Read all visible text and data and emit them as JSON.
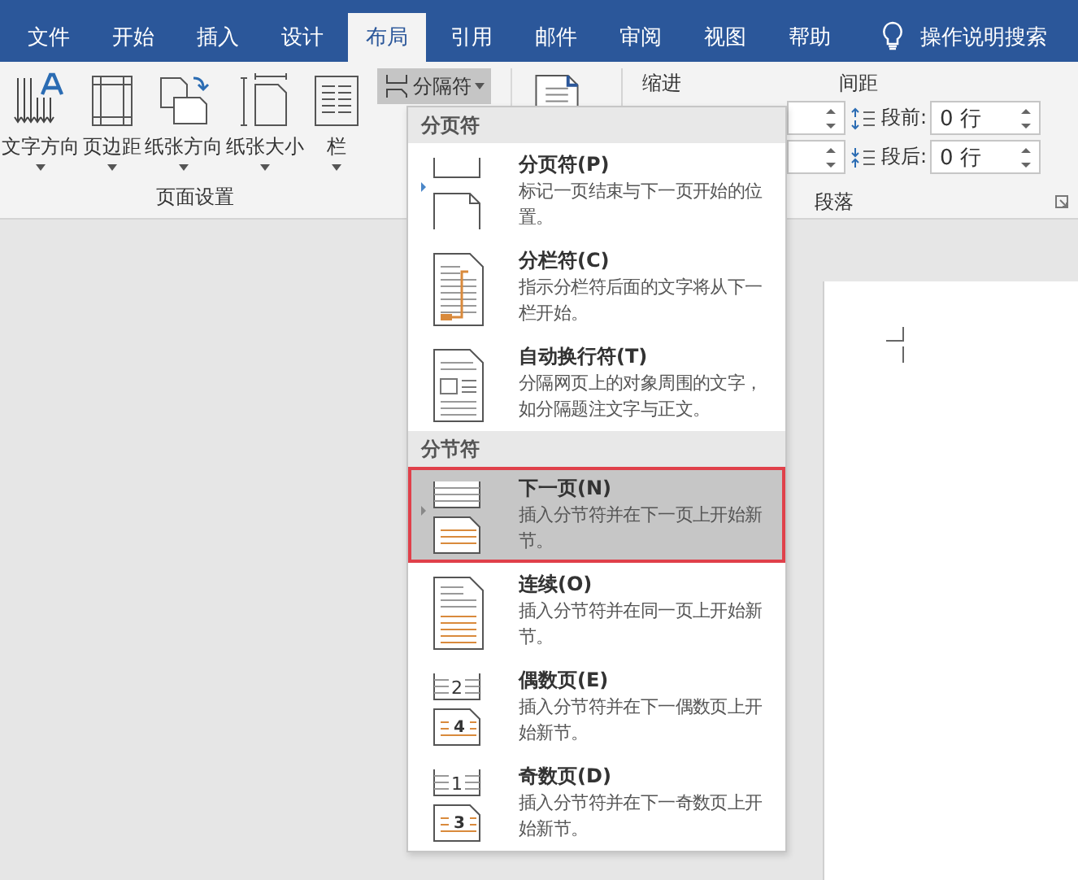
{
  "tabs": [
    {
      "label": "文件",
      "selected": false
    },
    {
      "label": "开始",
      "selected": false
    },
    {
      "label": "插入",
      "selected": false
    },
    {
      "label": "设计",
      "selected": false
    },
    {
      "label": "布局",
      "selected": true
    },
    {
      "label": "引用",
      "selected": false
    },
    {
      "label": "邮件",
      "selected": false
    },
    {
      "label": "审阅",
      "selected": false
    },
    {
      "label": "视图",
      "selected": false
    },
    {
      "label": "帮助",
      "selected": false
    }
  ],
  "tell_me": {
    "label": "操作说明搜索"
  },
  "page_setup": {
    "buttons": [
      {
        "kind": "text_direction",
        "label": "文字方向"
      },
      {
        "kind": "margins",
        "label": "页边距"
      },
      {
        "kind": "orientation",
        "label": "纸张方向"
      },
      {
        "kind": "size",
        "label": "纸张大小"
      },
      {
        "kind": "columns",
        "label": "栏"
      }
    ],
    "breaks_button": {
      "label": "分隔符",
      "expanded": true
    },
    "group_label": "页面设置"
  },
  "paragraph": {
    "indent_label": "缩进",
    "spacing_label": "间距",
    "spacing_fields": [
      {
        "kind": "before",
        "label": "段前:",
        "value": "0 行"
      },
      {
        "kind": "after",
        "label": "段后:",
        "value": "0 行"
      }
    ],
    "group_label": "段落"
  },
  "breaks_menu": {
    "sections": [
      {
        "title": "分页符",
        "items": [
          {
            "kind": "page",
            "title": "分页符(P)",
            "description": "标记一页结束与下一页开始的位置。",
            "selected": false
          },
          {
            "kind": "column",
            "title": "分栏符(C)",
            "description": "指示分栏符后面的文字将从下一栏开始。",
            "selected": false
          },
          {
            "kind": "text_wrapping",
            "title": "自动换行符(T)",
            "description": "分隔网页上的对象周围的文字，如分隔题注文字与正文。",
            "selected": false
          }
        ]
      },
      {
        "title": "分节符",
        "items": [
          {
            "kind": "next_page",
            "title": "下一页(N)",
            "description": "插入分节符并在下一页上开始新节。",
            "selected": true
          },
          {
            "kind": "continuous",
            "title": "连续(O)",
            "description": "插入分节符并在同一页上开始新节。",
            "selected": false
          },
          {
            "kind": "even_page",
            "title": "偶数页(E)",
            "description": "插入分节符并在下一偶数页上开始新节。",
            "page_numbers": [
              "2",
              "4"
            ],
            "selected": false
          },
          {
            "kind": "odd_page",
            "title": "奇数页(D)",
            "description": "插入分节符并在下一奇数页上开始新节。",
            "page_numbers": [
              "1",
              "3"
            ],
            "selected": false
          }
        ]
      }
    ]
  }
}
